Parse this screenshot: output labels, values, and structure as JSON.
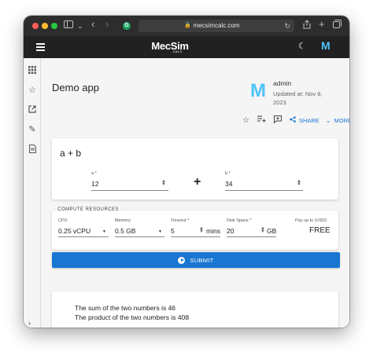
{
  "browser": {
    "url": "mecsimcalc.com",
    "extension_badge": "G"
  },
  "header": {
    "logo_text": "MecSim",
    "logo_sub": "CALC",
    "user_initial": "M"
  },
  "app": {
    "title": "Demo app",
    "logo_initial": "M",
    "author": "admin",
    "updated": "Updated at: Nov 8, 2023",
    "share_label": "SHARE",
    "more_label": "MORE"
  },
  "inputs": {
    "formula": "a + b",
    "a_label": "a *",
    "a_value": "12",
    "operator": "+",
    "b_label": "b *",
    "b_value": "34"
  },
  "compute": {
    "section_title": "COMPUTE RESOURCES",
    "cpu_label": "CPU",
    "cpu_value": "0.25 vCPU",
    "memory_label": "Memory",
    "memory_value": "0.5 GB",
    "timeout_label": "Timeout *",
    "timeout_value": "5",
    "timeout_unit": "mins",
    "disk_label": "Disk Space *",
    "disk_value": "20",
    "disk_unit": "GB",
    "price_label": "Pay up to (USD)",
    "price_value": "FREE"
  },
  "submit_label": "SUBMIT",
  "results": {
    "sum_line": "The sum of the two numbers is 46",
    "product_line": "The product of the two numbers is 408"
  },
  "colors": {
    "primary": "#1976d2",
    "appbar": "#212121",
    "logo_accent": "#4fc3f7"
  }
}
